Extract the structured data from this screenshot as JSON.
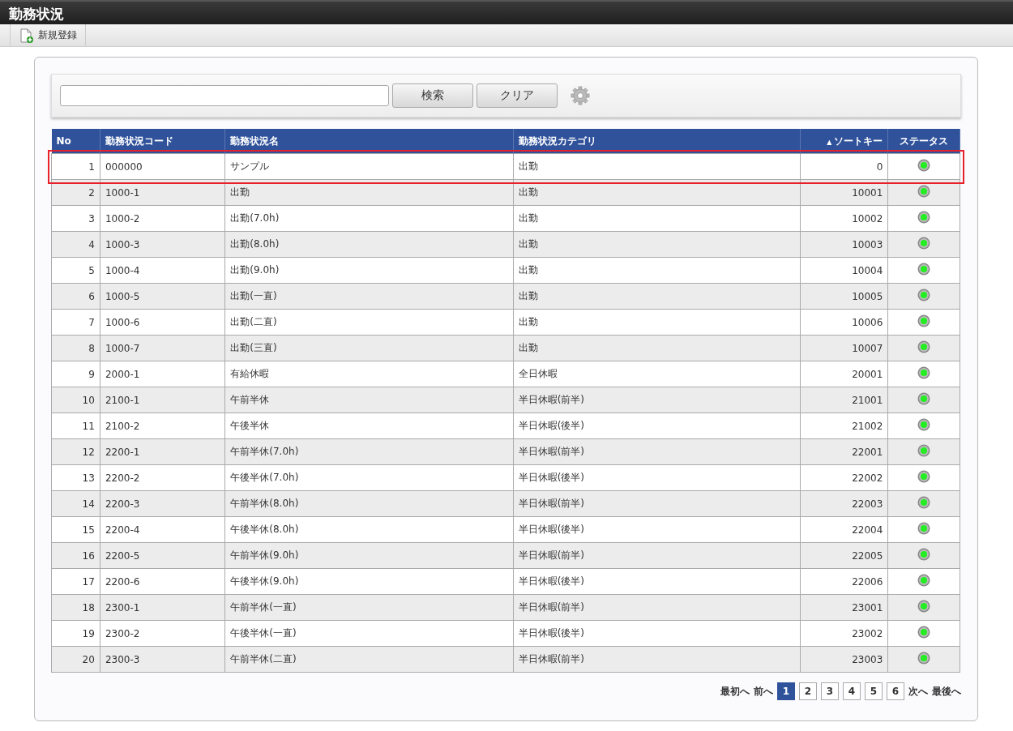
{
  "window": {
    "title": "勤務状況"
  },
  "toolbar": {
    "items": [
      {
        "label": "新規登録"
      }
    ]
  },
  "search": {
    "buttons": [
      "検索",
      "クリア"
    ]
  },
  "table": {
    "columns": [
      {
        "label": "No"
      },
      {
        "label": "勤務状況コード"
      },
      {
        "label": "勤務状況名"
      },
      {
        "label": "勤務状況カテゴリ"
      },
      {
        "label": "ソートキー",
        "sort_icon": "▲"
      },
      {
        "label": "ステータス"
      }
    ],
    "rows": [
      {
        "no": "1",
        "code": "000000",
        "name": "サンプル",
        "category": "出勤",
        "sort_key": "0",
        "enabled": true,
        "highlighted": true
      },
      {
        "no": "2",
        "code": "1000-1",
        "name": "出勤",
        "category": "出勤",
        "sort_key": "10001",
        "enabled": true,
        "highlighted": false
      },
      {
        "no": "3",
        "code": "1000-2",
        "name": "出勤(7.0h)",
        "category": "出勤",
        "sort_key": "10002",
        "enabled": true,
        "highlighted": false
      },
      {
        "no": "4",
        "code": "1000-3",
        "name": "出勤(8.0h)",
        "category": "出勤",
        "sort_key": "10003",
        "enabled": true,
        "highlighted": false
      },
      {
        "no": "5",
        "code": "1000-4",
        "name": "出勤(9.0h)",
        "category": "出勤",
        "sort_key": "10004",
        "enabled": true,
        "highlighted": false
      },
      {
        "no": "6",
        "code": "1000-5",
        "name": "出勤(一直)",
        "category": "出勤",
        "sort_key": "10005",
        "enabled": true,
        "highlighted": false
      },
      {
        "no": "7",
        "code": "1000-6",
        "name": "出勤(二直)",
        "category": "出勤",
        "sort_key": "10006",
        "enabled": true,
        "highlighted": false
      },
      {
        "no": "8",
        "code": "1000-7",
        "name": "出勤(三直)",
        "category": "出勤",
        "sort_key": "10007",
        "enabled": true,
        "highlighted": false
      },
      {
        "no": "9",
        "code": "2000-1",
        "name": "有給休暇",
        "category": "全日休暇",
        "sort_key": "20001",
        "enabled": true,
        "highlighted": false
      },
      {
        "no": "10",
        "code": "2100-1",
        "name": "午前半休",
        "category": "半日休暇(前半)",
        "sort_key": "21001",
        "enabled": true,
        "highlighted": false
      },
      {
        "no": "11",
        "code": "2100-2",
        "name": "午後半休",
        "category": "半日休暇(後半)",
        "sort_key": "21002",
        "enabled": true,
        "highlighted": false
      },
      {
        "no": "12",
        "code": "2200-1",
        "name": "午前半休(7.0h)",
        "category": "半日休暇(前半)",
        "sort_key": "22001",
        "enabled": true,
        "highlighted": false
      },
      {
        "no": "13",
        "code": "2200-2",
        "name": "午後半休(7.0h)",
        "category": "半日休暇(後半)",
        "sort_key": "22002",
        "enabled": true,
        "highlighted": false
      },
      {
        "no": "14",
        "code": "2200-3",
        "name": "午前半休(8.0h)",
        "category": "半日休暇(前半)",
        "sort_key": "22003",
        "enabled": true,
        "highlighted": false
      },
      {
        "no": "15",
        "code": "2200-4",
        "name": "午後半休(8.0h)",
        "category": "半日休暇(後半)",
        "sort_key": "22004",
        "enabled": true,
        "highlighted": false
      },
      {
        "no": "16",
        "code": "2200-5",
        "name": "午前半休(9.0h)",
        "category": "半日休暇(前半)",
        "sort_key": "22005",
        "enabled": true,
        "highlighted": false
      },
      {
        "no": "17",
        "code": "2200-6",
        "name": "午後半休(9.0h)",
        "category": "半日休暇(後半)",
        "sort_key": "22006",
        "enabled": true,
        "highlighted": false
      },
      {
        "no": "18",
        "code": "2300-1",
        "name": "午前半休(一直)",
        "category": "半日休暇(前半)",
        "sort_key": "23001",
        "enabled": true,
        "highlighted": false
      },
      {
        "no": "19",
        "code": "2300-2",
        "name": "午後半休(一直)",
        "category": "半日休暇(後半)",
        "sort_key": "23002",
        "enabled": true,
        "highlighted": false
      },
      {
        "no": "20",
        "code": "2300-3",
        "name": "午前半休(二直)",
        "category": "半日休暇(前半)",
        "sort_key": "23003",
        "enabled": true,
        "highlighted": false
      }
    ]
  },
  "pagination": {
    "first": "最初へ",
    "prev": "前へ",
    "pages": [
      {
        "label": "1",
        "selected": true
      },
      {
        "label": "2",
        "selected": false
      },
      {
        "label": "3",
        "selected": false
      },
      {
        "label": "4",
        "selected": false
      },
      {
        "label": "5",
        "selected": false
      },
      {
        "label": "6",
        "selected": false
      }
    ],
    "next": "次へ",
    "last": "最後へ"
  }
}
